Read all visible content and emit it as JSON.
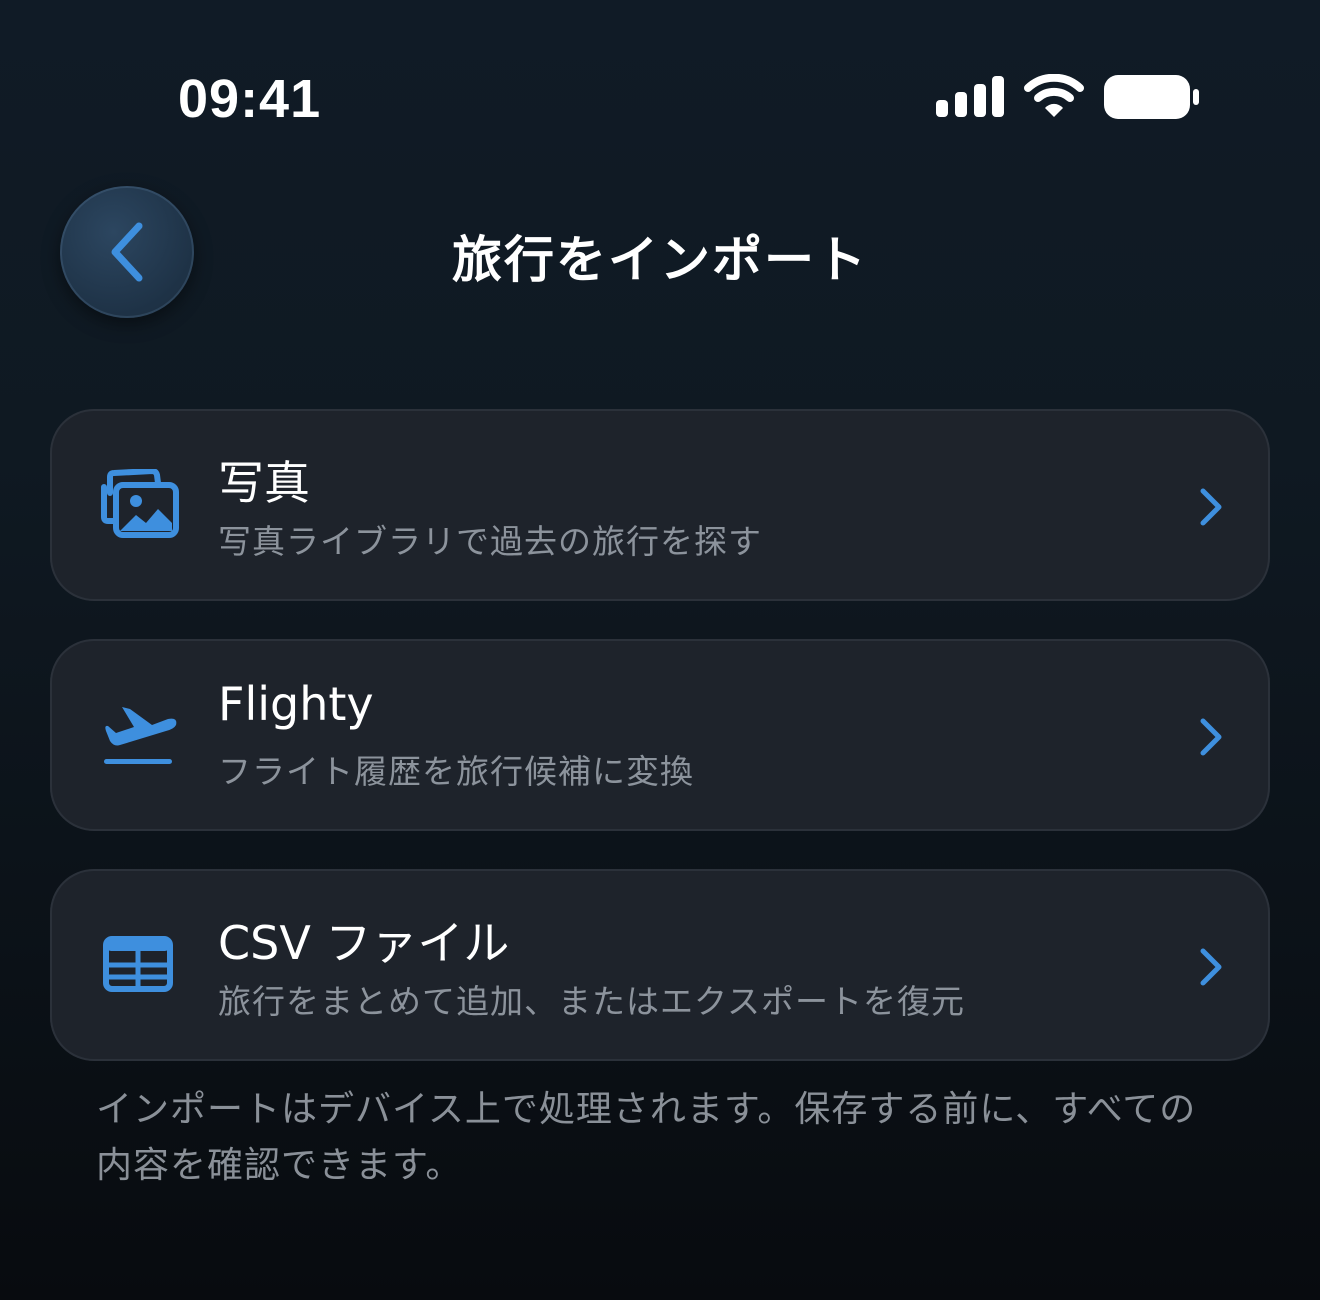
{
  "status_bar": {
    "time": "09:41",
    "icons": [
      "signal-icon",
      "wifi-icon",
      "battery-icon"
    ]
  },
  "nav": {
    "back_icon": "chevron-left-icon",
    "title": "旅行をインポート"
  },
  "options": [
    {
      "icon": "photos-icon",
      "title": "写真",
      "subtitle": "写真ライブラリで過去の旅行を探す"
    },
    {
      "icon": "airplane-takeoff-icon",
      "title": "Flighty",
      "subtitle": "フライト履歴を旅行候補に変換"
    },
    {
      "icon": "table-icon",
      "title": "CSV ファイル",
      "subtitle": "旅行をまとめて追加、またはエクスポートを復元"
    }
  ],
  "footnote": {
    "line1": "インポートはデバイス上で処理されます。保存する前に、すべての",
    "line2": "内容を確認できます。"
  },
  "colors": {
    "accent": "#3e8fde",
    "card_background": "#1e232b",
    "secondary_text": "#8c939c"
  }
}
